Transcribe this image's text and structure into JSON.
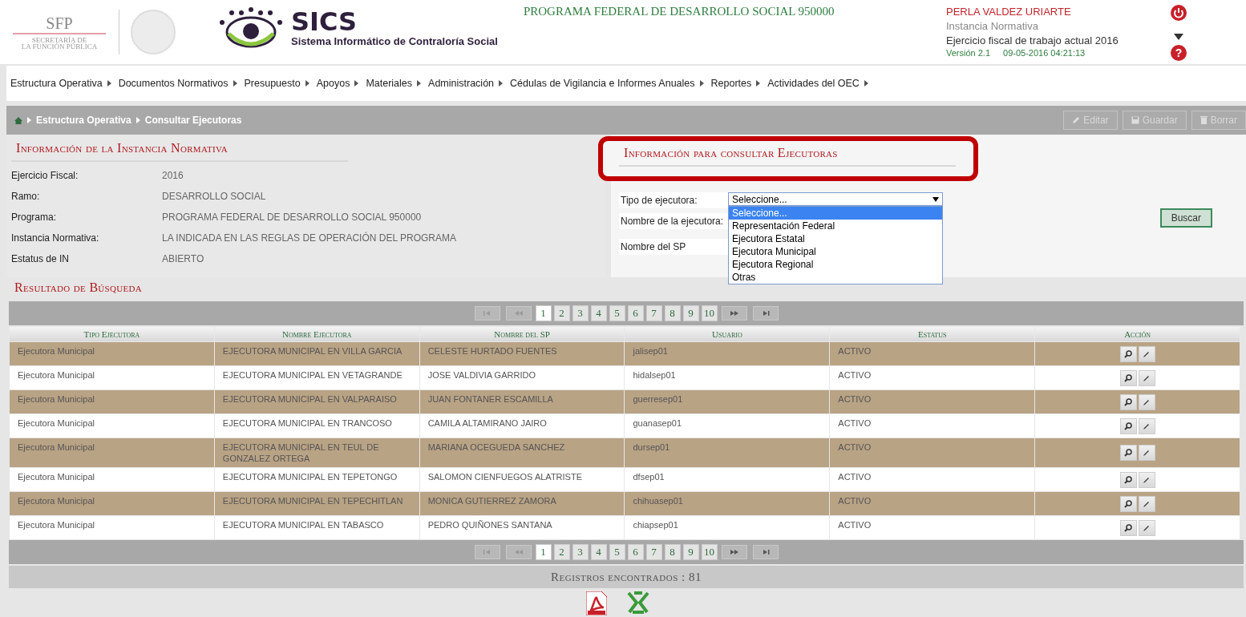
{
  "header": {
    "agency_logo": {
      "acronym": "SFP",
      "subtitle_line1": "SECRETARÍA DE",
      "subtitle_line2": "LA FUNCIÓN PÚBLICA"
    },
    "app_logo": {
      "name": "SICS",
      "subtitle": "Sistema Informático de Contraloría Social"
    },
    "program_title": "PROGRAMA FEDERAL DE DESARROLLO SOCIAL 950000",
    "user": {
      "name": "PERLA VALDEZ URIARTE",
      "role": "Instancia Normativa",
      "fiscal_year": "Ejercicio fiscal de trabajo actual  2016",
      "version": "Versión 2.1",
      "timestamp": "09-05-2016 04:21:13"
    },
    "help_symbol": "?"
  },
  "menu": [
    "Estructura Operativa",
    "Documentos Normativos",
    "Presupuesto",
    "Apoyos",
    "Materiales",
    "Administración",
    "Cédulas de Vigilancia e Informes Anuales",
    "Reportes",
    "Actividades del OEC"
  ],
  "breadcrumb": [
    "Estructura Operativa",
    "Consultar Ejecutoras"
  ],
  "toolbar": [
    {
      "label": "Editar",
      "kind": "edit",
      "disabled": true
    },
    {
      "label": "Guardar",
      "kind": "save",
      "disabled": true
    },
    {
      "label": "Borrar",
      "kind": "delete",
      "disabled": true
    }
  ],
  "info_panel": {
    "title": "Información de la Instancia Normativa",
    "fields": [
      {
        "label": "Ejercicio Fiscal:",
        "value": "2016"
      },
      {
        "label": "Ramo:",
        "value": "DESARROLLO SOCIAL"
      },
      {
        "label": "Programa:",
        "value": "PROGRAMA FEDERAL DE DESARROLLO SOCIAL 950000"
      },
      {
        "label": "Instancia Normativa:",
        "value": "LA INDICADA EN LAS REGLAS DE OPERACIÓN DEL PROGRAMA"
      },
      {
        "label": "Estatus de IN",
        "value": "ABIERTO"
      }
    ]
  },
  "search_panel": {
    "title": "Información para consultar Ejecutoras",
    "tipo_label": "Tipo de ejecutora:",
    "tipo_value": "Seleccione...",
    "expanded": true,
    "options": [
      {
        "label": "Seleccione...",
        "selected": true
      },
      {
        "label": "Representación Federal",
        "selected": false
      },
      {
        "label": "Ejecutora Estatal",
        "selected": false
      },
      {
        "label": "Ejecutora Municipal",
        "selected": false
      },
      {
        "label": "Ejecutora Regional",
        "selected": false
      },
      {
        "label": "Otras",
        "selected": false
      }
    ],
    "nombre_label": "Nombre de la ejecutora:",
    "sp_label": "Nombre del SP",
    "search_button": "Buscar"
  },
  "results": {
    "title": "Resultado de Búsqueda",
    "pages_top": [
      {
        "label": "1",
        "selected": true
      },
      {
        "label": "2",
        "selected": false
      },
      {
        "label": "3",
        "selected": false
      },
      {
        "label": "4",
        "selected": false
      },
      {
        "label": "5",
        "selected": false
      },
      {
        "label": "6",
        "selected": false
      },
      {
        "label": "7",
        "selected": false
      },
      {
        "label": "8",
        "selected": false
      },
      {
        "label": "9",
        "selected": false
      },
      {
        "label": "10",
        "selected": false
      }
    ],
    "pages_bottom": [
      {
        "label": "1",
        "selected": true
      },
      {
        "label": "2",
        "selected": false
      },
      {
        "label": "3",
        "selected": false
      },
      {
        "label": "4",
        "selected": false
      },
      {
        "label": "5",
        "selected": false
      },
      {
        "label": "6",
        "selected": false
      },
      {
        "label": "7",
        "selected": false
      },
      {
        "label": "8",
        "selected": false
      },
      {
        "label": "9",
        "selected": false
      },
      {
        "label": "10",
        "selected": false
      }
    ],
    "columns": [
      "Tipo Ejecutora",
      "Nombre Ejecutora",
      "Nombre del SP",
      "Usuario",
      "Estatus",
      "Acción"
    ],
    "rows": [
      [
        "Ejecutora Municipal",
        "EJECUTORA MUNICIPAL EN VILLA GARCIA",
        "CELESTE HURTADO FUENTES",
        "jalisep01",
        "ACTIVO"
      ],
      [
        "Ejecutora Municipal",
        "EJECUTORA MUNICIPAL EN VETAGRANDE",
        "JOSE VALDIVIA GARRIDO",
        "hidalsep01",
        "ACTIVO"
      ],
      [
        "Ejecutora Municipal",
        "EJECUTORA MUNICIPAL EN VALPARAISO",
        "JUAN FONTANER ESCAMILLA",
        "guerresep01",
        "ACTIVO"
      ],
      [
        "Ejecutora Municipal",
        "EJECUTORA MUNICIPAL EN TRANCOSO",
        "CAMILA ALTAMIRANO JAIRO",
        "guanasep01",
        "ACTIVO"
      ],
      [
        "Ejecutora Municipal",
        "EJECUTORA MUNICIPAL EN TEUL DE GONZALEZ ORTEGA",
        "MARIANA OCEGUEDA SANCHEZ",
        "dursep01",
        "ACTIVO"
      ],
      [
        "Ejecutora Municipal",
        "EJECUTORA MUNICIPAL EN TEPETONGO",
        "SALOMON CIENFUEGOS ALATRISTE",
        "dfsep01",
        "ACTIVO"
      ],
      [
        "Ejecutora Municipal",
        "EJECUTORA MUNICIPAL EN TEPECHITLAN",
        "MONICA GUTIERREZ ZAMORA",
        "chihuasep01",
        "ACTIVO"
      ],
      [
        "Ejecutora Municipal",
        "EJECUTORA MUNICIPAL EN TABASCO",
        "PEDRO QUIÑONES SANTANA",
        "chiapsep01",
        "ACTIVO"
      ]
    ],
    "total": "Registros encontrados : 81"
  }
}
